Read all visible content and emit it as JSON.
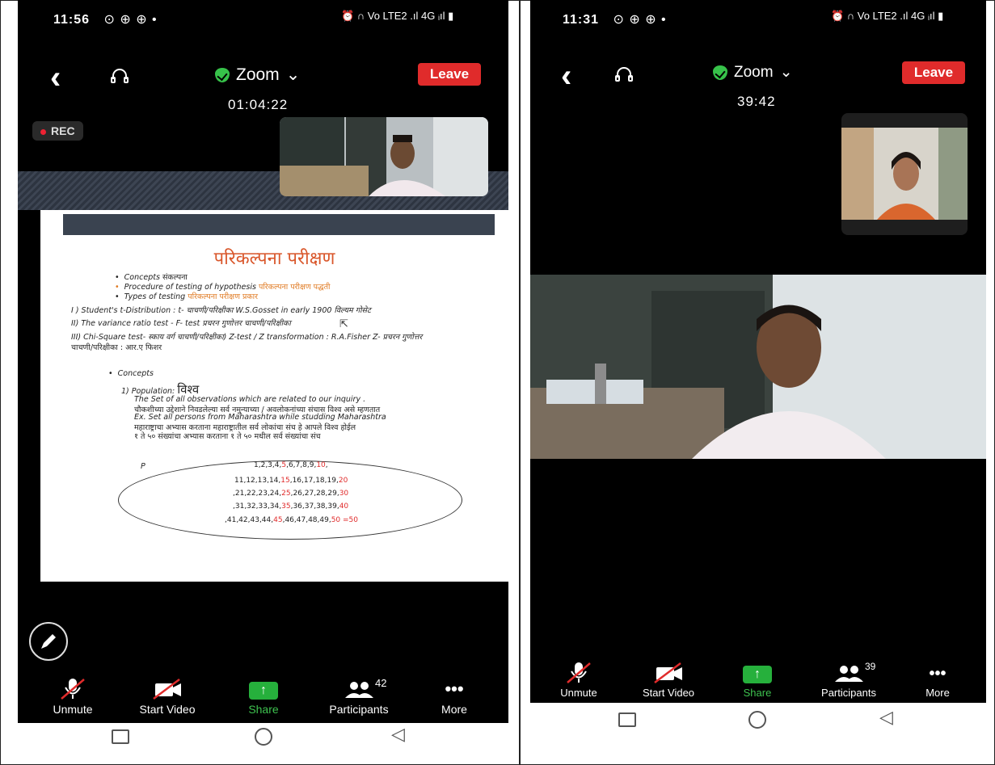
{
  "left": {
    "status_time": "11:56",
    "status_icons": "⊙ ⊕ ⊕ •",
    "status_right": "⏰ ∩ Vo LTE2 .ıl 4G ᵢıl ▮",
    "meeting_title": "Zoom",
    "leave_label": "Leave",
    "timer": "01:04:22",
    "rec_label": "REC",
    "doc": {
      "title": "परिकल्पना परीक्षण",
      "bullets": [
        {
          "en": "Concepts",
          "mr": "संकल्पना"
        },
        {
          "en": "Procedure of testing of hypothesis",
          "mr": "परिकल्पना परीक्षण पद्धती"
        },
        {
          "en": "Types of testing",
          "mr": "परिकल्पना परीक्षण प्रकार"
        }
      ],
      "line1": "I ) Student's t-Distribution :  t- चाचणी/परिक्षीका W.S.Gosset in early 1900 विल्यम गोसेट",
      "line2": "II) The variance ratio test - F- test प्रचरन गुणोत्तर चाचणी/परिक्षीका",
      "line3": "III) Chi-Square test-  स्काय वर्ग चाचणी/परिक्षीका) Z-test / Z transformation  : R.A.Fisher  Z- प्रचरन गुणोत्तर",
      "line4": "चाचणी/परिक्षीका :  आर.ए फिशर",
      "concepts": "Concepts",
      "population_label": "1)  Population:",
      "population_mr": "विश्व",
      "p1": "The Set of all observations which are related to our inquiry .",
      "p2": "चौकशीच्या उद्देशाने निवडलेल्या सर्व नमुन्याच्या /  अवलोकनांच्या संचास विश्व असे म्हणतात",
      "p3": "Ex. Set  all persons from Maharashtra while studding Maharashtra",
      "p4": "महाराष्ट्राचा अभ्यास करताना महाराष्ट्रातील सर्व लोकांचा संच हे आपले विश्व होईल",
      "p5": "१ ते ५० संख्यांचा अभ्यास करताना १ ते ५० मधील सर्व संख्यांचा संच",
      "p_label": "P",
      "rows": [
        [
          "1,2,3,4,",
          "5",
          ",6,7,8,9,",
          "10",
          ","
        ],
        [
          "11,12,13,14,",
          "15",
          ",16,17,18,19,",
          "20",
          ""
        ],
        [
          ",21,22,23,24,",
          "25",
          ",26,27,28,29,",
          "30",
          ""
        ],
        [
          ",31,32,33,34,",
          "35",
          ",36,37,38,39,",
          "40",
          ""
        ],
        [
          ",41,42,43,44,",
          "45",
          ",46,47,48,49,",
          "50",
          "  =50"
        ]
      ]
    },
    "toolbar": {
      "unmute": "Unmute",
      "start_video": "Start Video",
      "share": "Share",
      "participants": "Participants",
      "participants_count": "42",
      "more": "More"
    }
  },
  "right": {
    "status_time": "11:31",
    "status_icons": "⊙ ⊕ ⊕ •",
    "status_right": "⏰ ∩ Vo LTE2 .ıl 4G ᵢıl ▮",
    "meeting_title": "Zoom",
    "leave_label": "Leave",
    "timer": "39:42",
    "toolbar": {
      "unmute": "Unmute",
      "start_video": "Start Video",
      "share": "Share",
      "participants": "Participants",
      "participants_count": "39",
      "more": "More"
    }
  },
  "colors": {
    "leave": "#e02b2b",
    "share_green": "#26b03c",
    "shield": "#37c24a",
    "doc_title": "#d9572b"
  }
}
